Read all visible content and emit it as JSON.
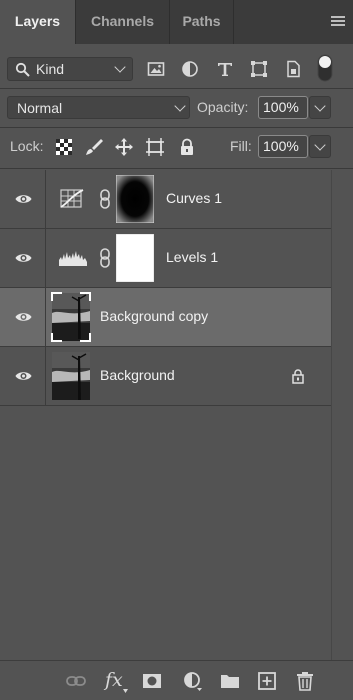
{
  "tabs": [
    {
      "label": "Layers",
      "active": true
    },
    {
      "label": "Channels",
      "active": false
    },
    {
      "label": "Paths",
      "active": false
    }
  ],
  "filter": {
    "kind_label": "Kind",
    "icons": [
      "image-filter-icon",
      "adjustment-filter-icon",
      "type-filter-icon",
      "shape-filter-icon",
      "smart-object-filter-icon",
      "filter-toggle-icon"
    ]
  },
  "blend": {
    "mode": "Normal",
    "opacity_label": "Opacity:",
    "opacity_value": "100%"
  },
  "lock": {
    "label": "Lock:",
    "icons": [
      "lock-transparent-pixels-icon",
      "lock-image-pixels-icon",
      "lock-position-icon",
      "lock-artboard-icon",
      "lock-all-icon"
    ],
    "fill_label": "Fill:",
    "fill_value": "100%"
  },
  "layers": [
    {
      "name": "Curves 1",
      "type": "curves-adjustment",
      "selected": false,
      "locked": false
    },
    {
      "name": "Levels 1",
      "type": "levels-adjustment",
      "selected": false,
      "locked": false
    },
    {
      "name": "Background copy",
      "type": "image",
      "selected": true,
      "locked": false
    },
    {
      "name": "Background",
      "type": "image",
      "selected": false,
      "locked": true
    }
  ],
  "bottom_bar": {
    "icons": [
      "link-layers-icon",
      "fx-icon",
      "add-mask-icon",
      "new-adjustment-icon",
      "new-group-icon",
      "new-layer-icon",
      "delete-layer-icon"
    ],
    "fx_label": "fx"
  },
  "colors": {
    "panel_bg": "#535353",
    "tab_bar_bg": "#3b3b3b",
    "selected_row": "#6b6b6b",
    "text": "#f2f2f2"
  }
}
